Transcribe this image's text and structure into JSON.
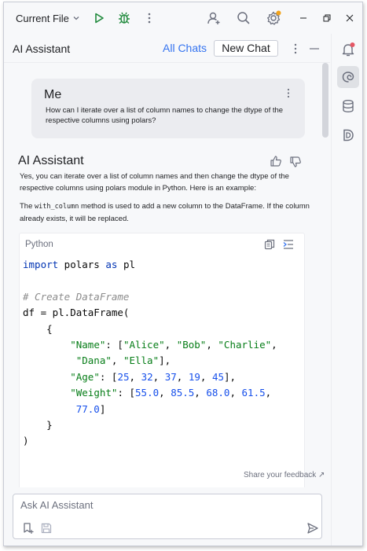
{
  "titlebar": {
    "run_config_label": "Current File",
    "icons": [
      "run-icon",
      "debug-icon",
      "more-vertical-icon",
      "add-user-icon",
      "search-icon",
      "settings-icon",
      "minimize-icon",
      "restore-icon",
      "close-icon"
    ]
  },
  "tool_window": {
    "title": "AI Assistant",
    "all_chats_label": "All Chats",
    "new_chat_label": "New Chat"
  },
  "right_stripe": {
    "items": [
      "notifications-icon",
      "ai-assistant-icon",
      "database-icon",
      "d-plugin-icon"
    ]
  },
  "chat": {
    "user_message": {
      "author": "Me",
      "text": "How can I iterate over a list of column names to change the dtype of the respective columns using polars?"
    },
    "assistant_message": {
      "author": "AI Assistant",
      "paragraph1": "Yes, you can iterate over a list of column names and then change the dtype of the respective columns using polars module in Python. Here is an example:",
      "paragraph2_code": "with_column",
      "paragraph2_before": "The ",
      "paragraph2_after": " method is used to add a new column to the DataFrame. If the column already exists, it will be replaced.",
      "code_block": {
        "language": "Python",
        "lines": [
          "import polars as pl",
          "",
          "# Create DataFrame",
          "df = pl.DataFrame(",
          "    {",
          "        \"Name\": [\"Alice\", \"Bob\", \"Charlie\",",
          "         \"Dana\", \"Ella\"],",
          "        \"Age\": [25, 32, 37, 19, 45],",
          "        \"Weight\": [55.0, 85.5, 68.0, 61.5,",
          "         77.0]",
          "    }",
          ")"
        ]
      }
    },
    "feedback_label": "Share your feedback ↗"
  },
  "input": {
    "placeholder": "Ask AI Assistant",
    "value": ""
  },
  "colors": {
    "accent": "#3574f0",
    "keyword": "#0033b3",
    "string": "#067d17",
    "number": "#1750eb",
    "comment": "#8c8c8c",
    "notification_badge": "#e55765",
    "settings_badge": "#f2a31b",
    "run_green": "#208a3c"
  }
}
